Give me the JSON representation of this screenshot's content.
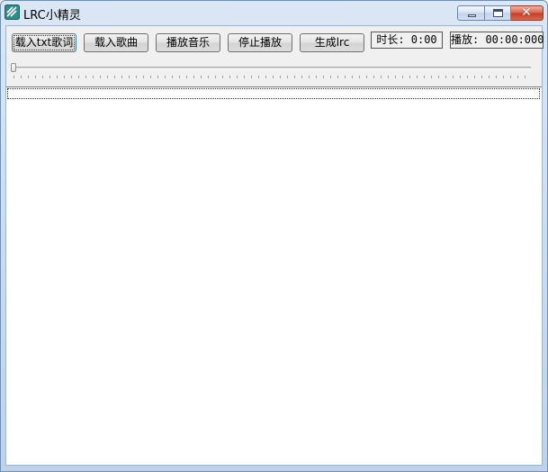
{
  "window": {
    "title": "LRC小精灵",
    "close_glyph": "✕"
  },
  "toolbar": {
    "load_txt_label": "载入txt歌词",
    "load_song_label": "载入歌曲",
    "play_label": "播放音乐",
    "stop_label": "停止播放",
    "generate_label": "生成lrc"
  },
  "status": {
    "duration_text": "时长: 0:00",
    "playback_text": "播放: 00:00:000"
  },
  "progress": {
    "fraction": 0
  },
  "icons": {
    "app": "app-icon",
    "minimize": "minimize-icon",
    "maximize": "maximize-icon",
    "close": "close-icon"
  },
  "colors": {
    "titlebar": "#c9daee",
    "client": "#f0f0f0",
    "close_button": "#c43a25"
  }
}
